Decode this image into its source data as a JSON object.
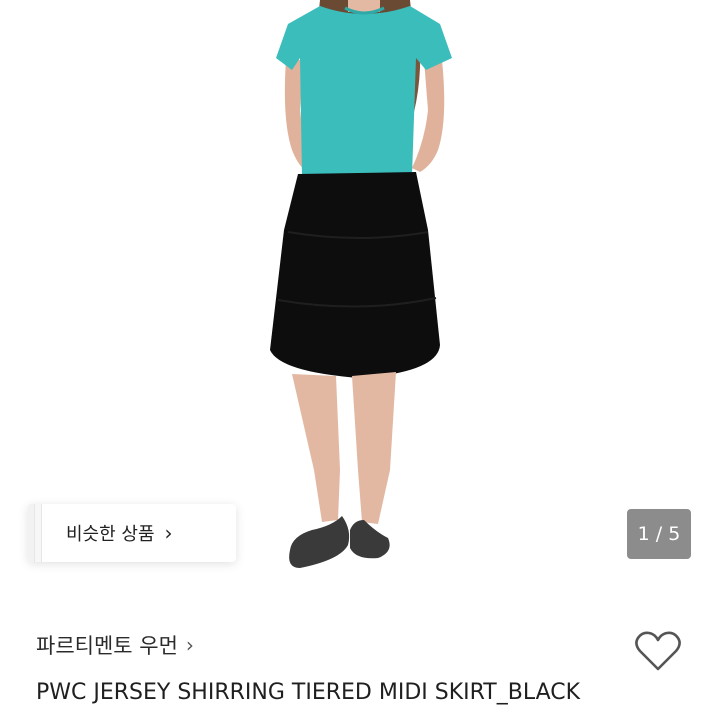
{
  "product": {
    "image_alt": "PWC JERSEY SHIRRING TIERED MIDI SKIRT_BLACK",
    "similar_label": "비슷한 상품",
    "page_current": "1",
    "page_total": "5",
    "page_indicator": "1 / 5",
    "brand": "파르티멘토 우먼",
    "title": "PWC JERSEY SHIRRING TIERED MIDI SKIRT_BLACK"
  },
  "icons": {
    "chevron": "chevron-right-icon",
    "heart": "heart-outline-icon"
  },
  "colors": {
    "top": "#3bbdbc",
    "skirt": "#0d0d0d",
    "indicator_bg": "#7a7a7a"
  }
}
